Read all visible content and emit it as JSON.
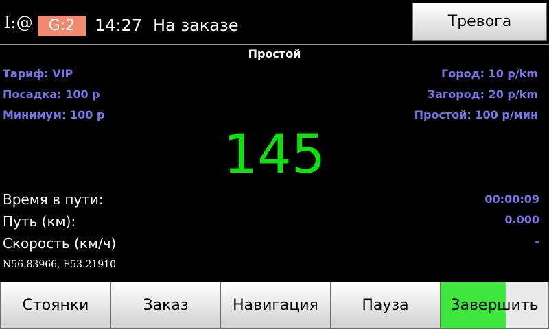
{
  "status": {
    "indicator": "I:@",
    "gps_badge": "G:2",
    "time": "14:27",
    "order_state": "На заказе",
    "alarm_label": "Тревога"
  },
  "mode": "Простой",
  "tariff": {
    "name": "Тариф: VIP",
    "boarding": "Посадка: 100 р",
    "minimum": "Минимум: 100 р",
    "city": "Город: 10 р/km",
    "suburb": "Загород: 20 р/km",
    "idle": "Простой: 100 р/мин"
  },
  "fare": "145",
  "trip": {
    "time_label": "Время в пути:",
    "time_value": "00:00:09",
    "distance_label": "Путь (км):",
    "distance_value": "0.000",
    "speed_label": "Скорость (км/ч)",
    "speed_value": "-"
  },
  "coordinates": "N56.83966, E53.21910",
  "buttons": {
    "parking": "Стоянки",
    "order": "Заказ",
    "navigation": "Навигация",
    "pause": "Пауза",
    "finish": "Завершить"
  },
  "colors": {
    "accent_text": "#7a74e8",
    "fare_green": "#10e010",
    "gps_badge": "#f08a70",
    "finish_green": "#3ee63e"
  }
}
